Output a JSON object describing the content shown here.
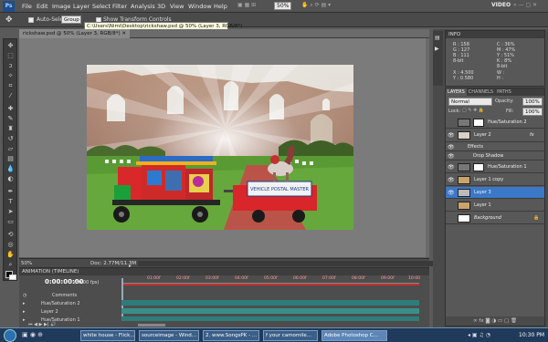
{
  "app": {
    "logo": "Ps"
  },
  "menu": [
    "File",
    "Edit",
    "Image",
    "Layer",
    "Select",
    "Filter",
    "Analysis",
    "3D",
    "View",
    "Window",
    "Help"
  ],
  "zoom_combo": "50%",
  "workspace": "VIDEO",
  "options": {
    "auto_select": "Auto-Select:",
    "auto_select_value": "Group",
    "transform": "Show Transform Controls"
  },
  "document": {
    "tab_title": "rickshaw.psd @ 50% (Layer 3, RGB/8*)",
    "tooltip": "C:\\Users\\Nimi\\Desktop\\rickshaw.psd @ 50% (Layer 3, RGB/8*)",
    "zoom": "50%",
    "doc_size": "Doc: 2.77M/11.3M",
    "sign": "VEHICLE POSTAL MASTER"
  },
  "info": {
    "title": "INFO",
    "r": "R :",
    "r_val": "158",
    "g": "G :",
    "g_val": "127",
    "b": "B :",
    "b_val": "111",
    "bit1": "8-bit",
    "c": "C :",
    "c_val": "36%",
    "m": "M :",
    "m_val": "47%",
    "y": "Y :",
    "y_val": "51%",
    "k": "K :",
    "k_val": "8%",
    "bit2": "8-bit",
    "x": "X :",
    "x_val": "4.500",
    "yy": "Y :",
    "yy_val": "0.580",
    "w": "W :",
    "h": "H :"
  },
  "layers": {
    "tabs": [
      "LAYERS",
      "CHANNELS",
      "PATHS"
    ],
    "blend": "Normal",
    "opacity_label": "Opacity:",
    "opacity": "100%",
    "lock_label": "Lock:",
    "fill_label": "Fill:",
    "fill": "100%",
    "items": [
      {
        "name": "Hue/Saturation 2"
      },
      {
        "name": "Layer 2",
        "fx": "fx"
      },
      {
        "name": "Effects"
      },
      {
        "name": "Drop Shadow"
      },
      {
        "name": "Hue/Saturation 1"
      },
      {
        "name": "Layer 1 copy"
      },
      {
        "name": "Layer 3"
      },
      {
        "name": "Layer 1"
      },
      {
        "name": "Background"
      }
    ],
    "footer_icons": [
      "link-icon",
      "fx-icon",
      "mask-icon",
      "adjustment-icon",
      "folder-icon",
      "new-layer-icon",
      "trash-icon"
    ]
  },
  "animation": {
    "title": "ANIMATION (TIMELINE)",
    "timecode": "0:00:00:00",
    "fps": "(30.00 fps)",
    "ruler": [
      "01:00f",
      "02:00f",
      "03:00f",
      "04:00f",
      "05:00f",
      "06:00f",
      "07:00f",
      "08:00f",
      "09:00f",
      "10:00"
    ],
    "tracks": [
      "Comments",
      "Hue/Saturation 2",
      "Layer 2",
      "Hue/Saturation 1"
    ]
  },
  "taskbar": {
    "items": [
      "white house - Flick...",
      "sourceimage - Wind...",
      "2. www.SongsPK - ...",
      "f your camomile...",
      "Adobe Photoshop C..."
    ],
    "active": 4,
    "clock": "10:30 PM"
  },
  "colors": {
    "highlight": "#3b78c8",
    "timeline_red": "#c8322a",
    "track": "#2f7d7a"
  }
}
